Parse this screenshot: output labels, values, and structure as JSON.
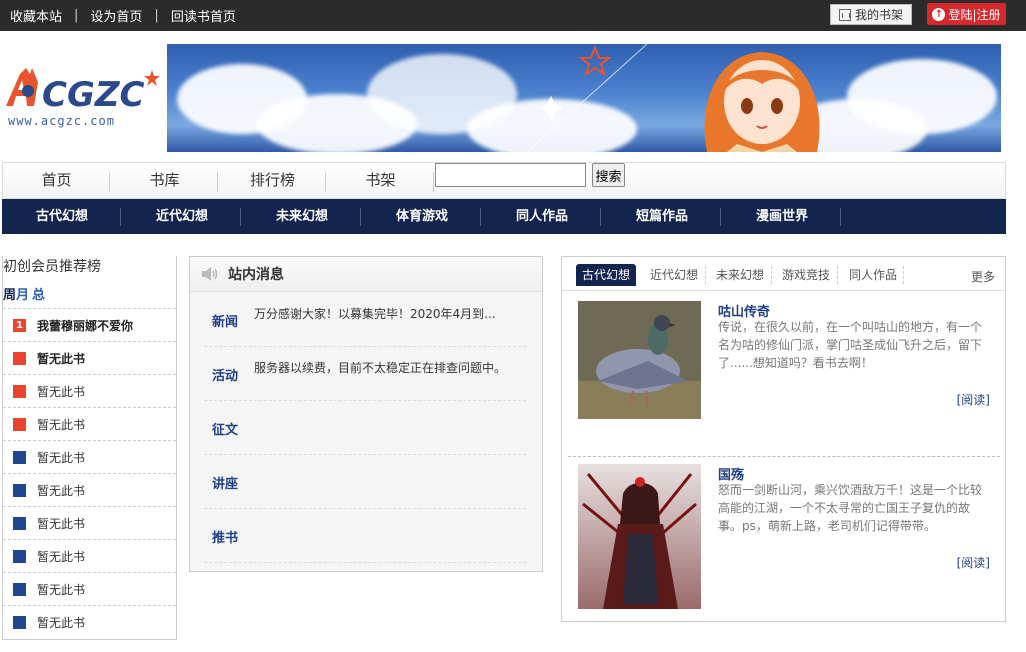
{
  "topbar": {
    "links": [
      "收藏本站",
      "设为首页",
      "回读书首页"
    ],
    "shelf_label": "我的书架",
    "login_label": "登陆|注册"
  },
  "logo": {
    "mark": "ACGZC",
    "url": "www.acgzc.com"
  },
  "mainnav": {
    "items": [
      "首页",
      "书库",
      "排行榜",
      "书架"
    ],
    "search_value": "",
    "search_button": "搜索"
  },
  "categories": [
    "古代幻想",
    "近代幻想",
    "未来幻想",
    "体育游戏",
    "同人作品",
    "短篇作品",
    "漫画世界"
  ],
  "ranking": {
    "title": "初创会员推荐榜",
    "tab_week": "周",
    "tab_month": "月",
    "tab_total": "总",
    "items": [
      {
        "num": "1",
        "name": "我蕾穆丽娜不爱你",
        "color": "#e8452c"
      },
      {
        "num": "",
        "name": "暂无此书",
        "color": "#e8452c"
      },
      {
        "num": "",
        "name": "暂无此书",
        "color": "#e8452c"
      },
      {
        "num": "",
        "name": "暂无此书",
        "color": "#e8452c"
      },
      {
        "num": "",
        "name": "暂无此书",
        "color": "#1f4790"
      },
      {
        "num": "",
        "name": "暂无此书",
        "color": "#1f4790"
      },
      {
        "num": "",
        "name": "暂无此书",
        "color": "#1f4790"
      },
      {
        "num": "",
        "name": "暂无此书",
        "color": "#1f4790"
      },
      {
        "num": "",
        "name": "暂无此书",
        "color": "#1f4790"
      },
      {
        "num": "",
        "name": "暂无此书",
        "color": "#1f4790"
      }
    ]
  },
  "news": {
    "title": "站内消息",
    "rows": [
      {
        "label": "新闻",
        "text": "万分感谢大家！以募集完毕！2020年4月到..."
      },
      {
        "label": "活动",
        "text": "服务器以续费，目前不太稳定正在排查问题中。"
      },
      {
        "label": "征文",
        "text": ""
      },
      {
        "label": "讲座",
        "text": ""
      },
      {
        "label": "推书",
        "text": ""
      }
    ]
  },
  "featured": {
    "tabs": [
      "古代幻想",
      "近代幻想",
      "未来幻想",
      "游戏竞技",
      "同人作品"
    ],
    "more": "更多",
    "books": [
      {
        "name": "咕山传奇",
        "desc": "传说，在很久以前，在一个叫咕山的地方，有一个名为咕的修仙门派，掌门咕圣成仙飞升之后，留下了......想知道吗？看书去啊！",
        "read": "[阅读]"
      },
      {
        "name": "国殇",
        "desc": "怒而一剑断山河，乘兴饮酒敌万千！这是一个比较高能的江湖，一个不太寻常的亡国王子复仇的故事。ps，萌新上路，老司机们记得带带。",
        "read": "[阅读]"
      }
    ]
  },
  "colors": {
    "navy": "#13254f",
    "red": "#d6282d",
    "accent_blue": "#1f3f86"
  }
}
